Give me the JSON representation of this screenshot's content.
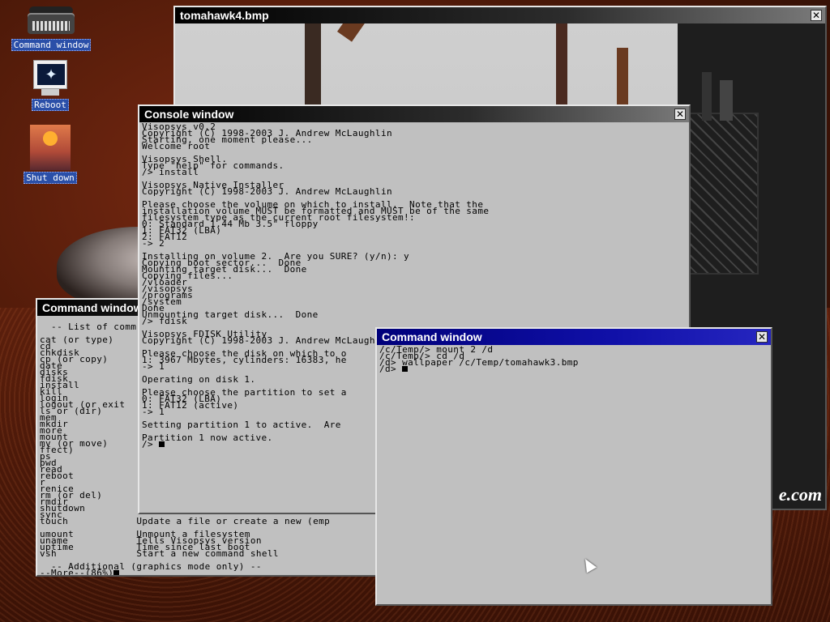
{
  "desktop": {
    "icons": [
      {
        "label": "Command window"
      },
      {
        "label": "Reboot"
      },
      {
        "label": "Shut down"
      }
    ]
  },
  "image_window": {
    "title": "tomahawk4.bmp",
    "watermark": "e.com"
  },
  "console_window": {
    "title": "Console window",
    "lines": [
      "Visopsys v0.2",
      "Copyright (C) 1998-2003 J. Andrew McLaughlin",
      "Starting, one moment please...",
      "Welcome root",
      "",
      "Visopsys Shell.",
      "Type \"help\" for commands.",
      "/> install",
      "",
      "Visopsys Native Installer",
      "Copyright (C) 1998-2003 J. Andrew McLaughlin",
      "",
      "Please choose the volume on which to install.  Note that the",
      "installation volume MUST be formatted and MUST be of the same",
      "filesystem type as the current root filesystem!:",
      "0: Standard 1.44 Mb 3.5\" floppy",
      "1: FAT32 (LBA)",
      "2: FAT12",
      "-> 2",
      "",
      "Installing on volume 2.  Are you SURE? (y/n): y",
      "Copying boot sector...  Done",
      "Mounting target disk...  Done",
      "Copying files...",
      "/vloader",
      "/visopsys",
      "/programs",
      "/system",
      "Done",
      "Unmounting target disk...  Done",
      "/> fdisk",
      "",
      "Visopsys FDISK Utility",
      "Copyright (C) 1998-2003 J. Andrew McLaughlin",
      "",
      "Please choose the disk on which to o",
      "1: 3967 Mbytes, cylinders: 16383, he",
      "-> 1",
      "",
      "Operating on disk 1.",
      "",
      "Please choose the partition to set a",
      "0: FAT32 (LBA)",
      "1: FAT12 (active)",
      "-> 1",
      "",
      "Setting partition 1 to active.  Are",
      "",
      "Partition 1 now active.",
      "/> "
    ]
  },
  "command_window_back": {
    "title": "Command window",
    "lines": [
      "",
      "  -- List of comm",
      "",
      "cat (or type)",
      "cd",
      "chkdisk",
      "cp (or copy)",
      "date",
      "disks",
      "fdisk",
      "install",
      "kill",
      "login",
      "logout (or exit",
      "ls or (dir)",
      "mem",
      "mkdir",
      "more",
      "mount",
      "mv (or move)",
      "ffect)",
      "ps",
      "pwd",
      "read",
      "reboot",
      "r",
      "renice",
      "rm (or del)",
      "rmdir",
      "shutdown",
      "sync",
      "touch            Update a file or create a new (emp",
      "",
      "umount           Unmount a filesystem",
      "uname            Tells Visopsys version",
      "uptime           Time since last boot",
      "vsh              Start a new command shell",
      "",
      "  -- Additional (graphics mode only) --"
    ],
    "more_prompt": "--More--(86%)"
  },
  "command_window_front": {
    "title": "Command window",
    "lines": [
      "/c/Temp/> mount 2 /d",
      "/c/Temp/> cd /d",
      "/d> wallpaper /c/Temp/tomahawk3.bmp",
      "/d> "
    ]
  }
}
